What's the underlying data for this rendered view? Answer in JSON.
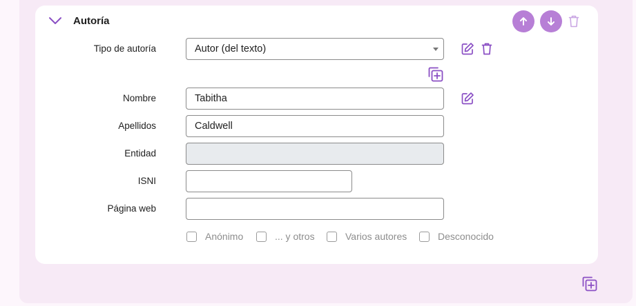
{
  "section": {
    "title": "Autoría"
  },
  "colors": {
    "accent": "#b77fd6",
    "icon": "#8a4fc4",
    "background": "#f7eaf6"
  },
  "icons": {
    "collapse": "chevron-down-icon",
    "move_up": "arrow-up-icon",
    "move_down": "arrow-down-icon",
    "delete": "trash-icon",
    "edit": "edit-icon",
    "add": "add-copy-icon"
  },
  "form": {
    "tipo": {
      "label": "Tipo de autoría",
      "value": "Autor (del texto)"
    },
    "nombre": {
      "label": "Nombre",
      "value": "Tabitha"
    },
    "apellidos": {
      "label": "Apellidos",
      "value": "Caldwell"
    },
    "entidad": {
      "label": "Entidad",
      "value": ""
    },
    "isni": {
      "label": "ISNI",
      "value": ""
    },
    "web": {
      "label": "Página web",
      "value": ""
    }
  },
  "checkboxes": [
    {
      "label": "Anónimo",
      "checked": false
    },
    {
      "label": "... y otros",
      "checked": false
    },
    {
      "label": "Varios autores",
      "checked": false
    },
    {
      "label": "Desconocido",
      "checked": false
    }
  ]
}
